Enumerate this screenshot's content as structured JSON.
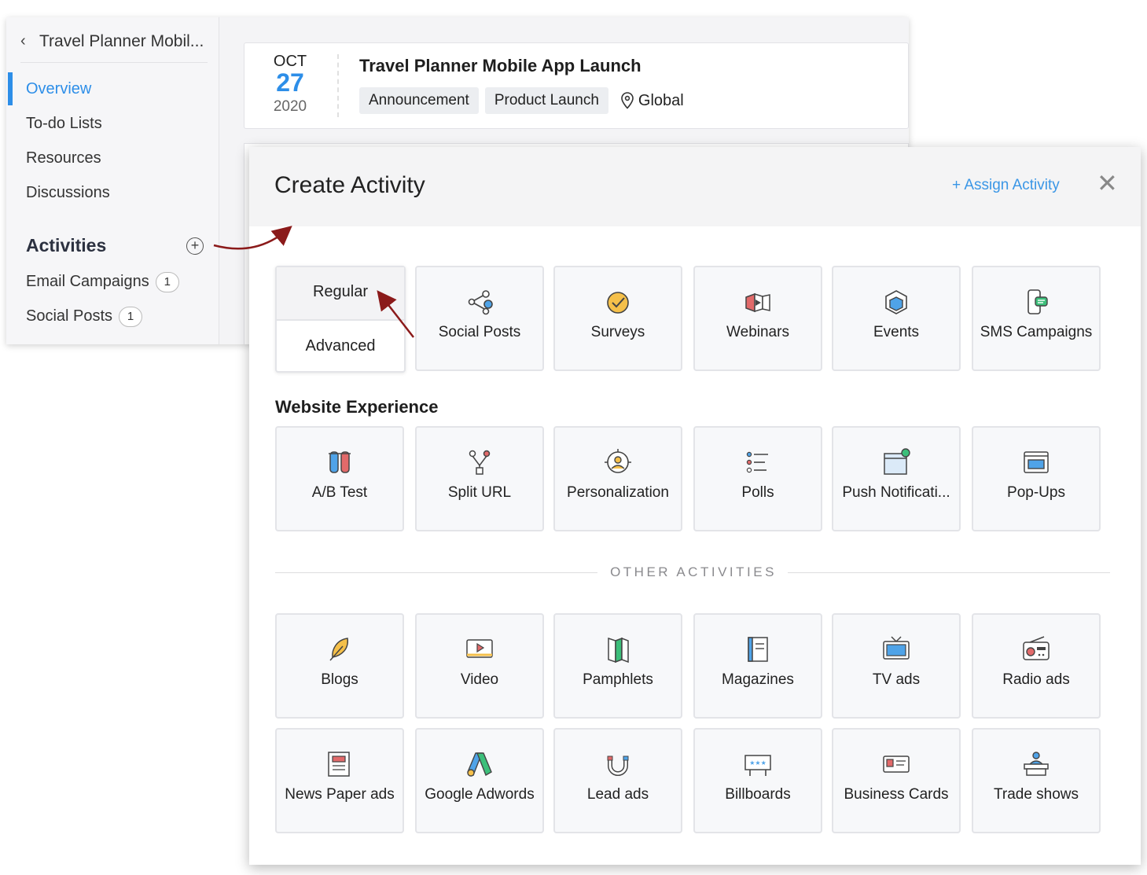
{
  "sidebar": {
    "back_title": "Travel Planner Mobil...",
    "nav": [
      "Overview",
      "To-do Lists",
      "Resources",
      "Discussions"
    ],
    "activities_heading": "Activities",
    "activity_items": [
      {
        "label": "Email Campaigns",
        "count": "1"
      },
      {
        "label": "Social Posts",
        "count": "1"
      }
    ]
  },
  "event": {
    "month": "OCT",
    "day": "27",
    "year": "2020",
    "title": "Travel Planner Mobile App Launch",
    "tags": [
      "Announcement",
      "Product Launch"
    ],
    "location": "Global"
  },
  "modal": {
    "title": "Create Activity",
    "assign_link": "+ Assign Activity",
    "close": "✕",
    "email_options": {
      "regular": "Regular",
      "advanced": "Advanced"
    },
    "row1": [
      "Social Posts",
      "Surveys",
      "Webinars",
      "Events",
      "SMS Campaigns"
    ],
    "website_heading": "Website Experience",
    "website": [
      "A/B Test",
      "Split URL",
      "Personalization",
      "Polls",
      "Push Notificati...",
      "Pop-Ups"
    ],
    "other_heading": "OTHER ACTIVITIES",
    "other_row1": [
      "Blogs",
      "Video",
      "Pamphlets",
      "Magazines",
      "TV ads",
      "Radio ads"
    ],
    "other_row2": [
      "News Paper ads",
      "Google Adwords",
      "Lead ads",
      "Billboards",
      "Business Cards",
      "Trade shows"
    ]
  },
  "colors": {
    "accent": "#2d8ee8",
    "arrow": "#8b1a1a"
  }
}
